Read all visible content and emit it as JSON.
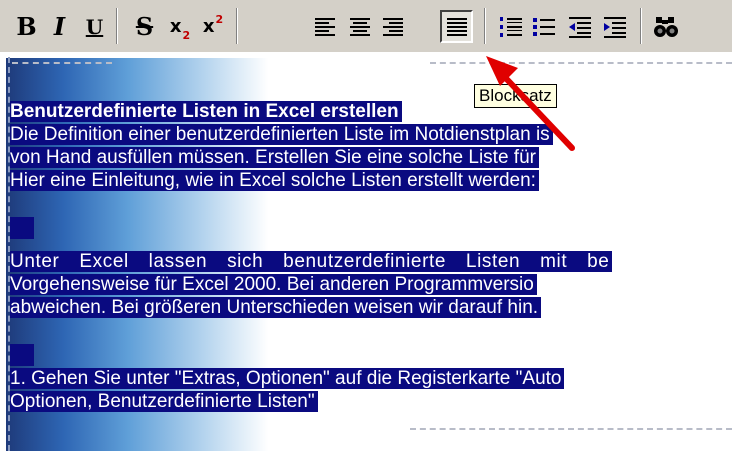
{
  "toolbar": {
    "bold_label": "B",
    "italic_label": "I",
    "underline_label": "U",
    "strike_label": "S",
    "subscript_base": "x",
    "subscript_mark": "2",
    "superscript_base": "x",
    "superscript_mark": "2",
    "pressed_button": "align-justify",
    "icons": [
      "bold-icon",
      "italic-icon",
      "underline-icon",
      "strikethrough-icon",
      "subscript-icon",
      "superscript-icon",
      "align-left-icon",
      "align-center-icon",
      "align-right-icon",
      "align-justify-icon",
      "numbered-list-icon",
      "bullet-list-icon",
      "outdent-icon",
      "indent-icon",
      "find-icon"
    ]
  },
  "tooltip": {
    "text": "Blocksatz"
  },
  "document": {
    "heading": "Benutzerdefinierte Listen in Excel erstellen",
    "lines": [
      "Die Definition einer benutzerdefinierten Liste im Notdienstplan is",
      "von Hand ausfüllen müssen. Erstellen Sie eine solche Liste für",
      "Hier eine Einleitung, wie in Excel solche Listen erstellt werden:",
      "",
      "Unter Excel lassen sich benutzerdefinierte Listen mit be",
      "Vorgehensweise für Excel 2000. Bei anderen Programmversio",
      "abweichen. Bei größeren Unterschieden weisen wir darauf hin.",
      "",
      "1. Gehen Sie unter \"Extras, Optionen\" auf die Registerkarte \"Auto",
      "Optionen, Benutzerdefinierte Listen\""
    ]
  },
  "colors": {
    "selection": "#0a0a80",
    "toolbar_bg": "#d4d0c8",
    "arrow": "#e00000",
    "tooltip_bg": "#ffffe1"
  }
}
